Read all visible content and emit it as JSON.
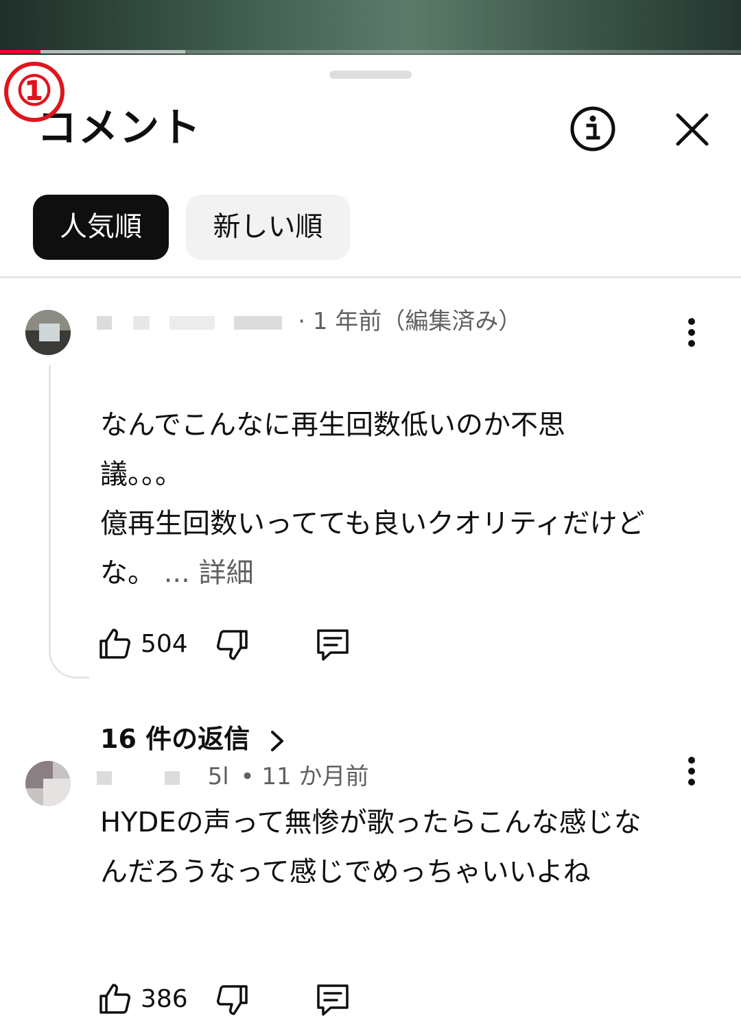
{
  "annotation": {
    "marker": "①"
  },
  "player": {
    "progress_fraction": 0.055,
    "buffered_fraction": 0.25,
    "progress_color": "#ff0033"
  },
  "header": {
    "title": "コメント",
    "info_icon": "info-icon",
    "close_icon": "close-icon"
  },
  "sort_tabs": {
    "top": "人気順",
    "newest": "新しい順"
  },
  "comments": [
    {
      "author_censored": true,
      "meta": "1 年前（編集済み）",
      "lines": [
        "なんでこんなに再生回数低いのか不思",
        "議。。。",
        "億再生回数いってても良いクオリティだけど",
        "な。"
      ],
      "more_label": "... 詳細",
      "likes": "504",
      "replies_label": "16 件の返信"
    },
    {
      "author_censored": true,
      "author_suffix": "5l",
      "meta": "11 か月前",
      "lines": [
        "HYDEの声って無惨が歌ったらこんな感じな",
        "んだろうなって感じでめっちゃいいよね"
      ],
      "likes": "386"
    }
  ],
  "colors": {
    "accent": "#0f0f0f",
    "marker": "#e0141c",
    "secondary_text": "#606060"
  }
}
